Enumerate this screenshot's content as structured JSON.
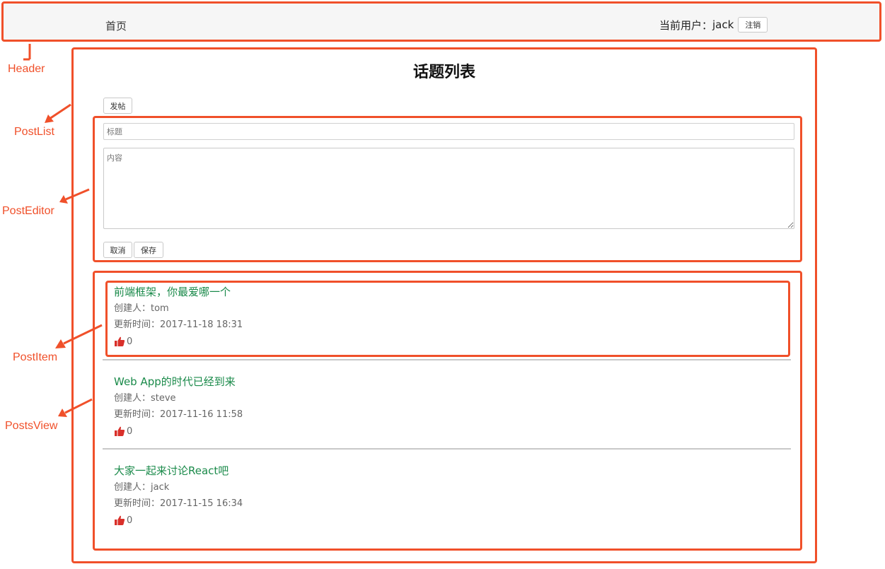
{
  "header": {
    "nav_home": "首页",
    "current_user_label": "当前用户：",
    "current_user": "jack",
    "logout_label": "注销"
  },
  "page_title": "话题列表",
  "post_button_label": "发帖",
  "editor": {
    "title_placeholder": "标题",
    "content_placeholder": "内容",
    "cancel_label": "取消",
    "save_label": "保存"
  },
  "posts": [
    {
      "title": "前端框架，你最爱哪一个",
      "author_line": "创建人：tom",
      "updated_line": "更新时间：2017-11-18 18:31",
      "likes": "0"
    },
    {
      "title": "Web App的时代已经到来",
      "author_line": "创建人：steve",
      "updated_line": "更新时间：2017-11-16 11:58",
      "likes": "0"
    },
    {
      "title": "大家一起来讨论React吧",
      "author_line": "创建人：jack",
      "updated_line": "更新时间：2017-11-15 16:34",
      "likes": "0"
    }
  ],
  "annotations": {
    "header": "Header",
    "post_list": "PostList",
    "post_editor": "PostEditor",
    "post_item": "PostItem",
    "posts_view": "PostsView"
  },
  "colors": {
    "annotation": "#f0502a",
    "post_title": "#1a8a4a",
    "thumb_icon": "#d9302a"
  }
}
